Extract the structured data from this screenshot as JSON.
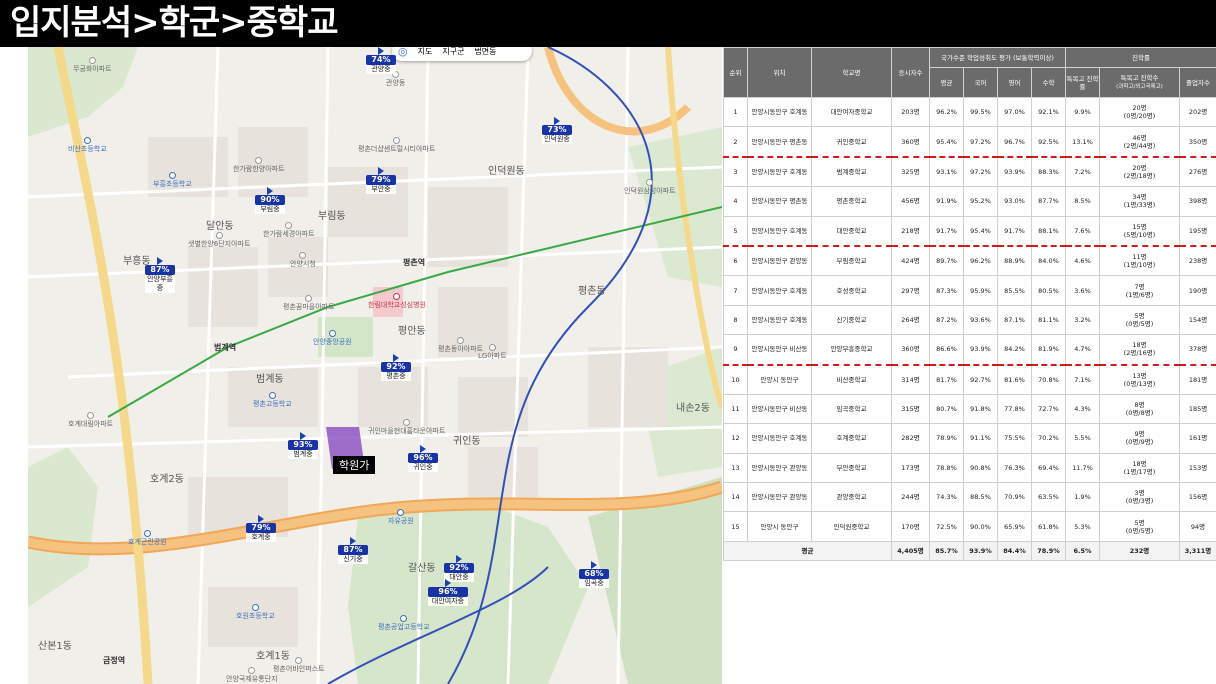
{
  "header": {
    "title": "입지분석>학군>중학교"
  },
  "map": {
    "controls": {
      "icon": "location-icon",
      "items": [
        "지도",
        "지구군",
        "법면동"
      ]
    },
    "academy_label": "학원가",
    "stations": [
      "평촌역",
      "범계역",
      "금정역"
    ],
    "districts": [
      "부림동",
      "평안동",
      "귀인동",
      "평촌동",
      "범계동",
      "호계2동",
      "갈산동",
      "호계1동",
      "부흥동",
      "산본1동",
      "달안동",
      "내손2동",
      "인덕원동"
    ],
    "pois": [
      {
        "name": "안양중앙공원",
        "style": "blue"
      },
      {
        "name": "평촌고등학교",
        "style": "blue"
      },
      {
        "name": "부흥초등학교",
        "style": "blue"
      },
      {
        "name": "한가람한양아파트",
        "style": "gray"
      },
      {
        "name": "안양시청",
        "style": "gray"
      },
      {
        "name": "평촌동아아파트",
        "style": "gray"
      },
      {
        "name": "평촌더샵센트럴시티아파트",
        "style": "gray"
      },
      {
        "name": "인덕원삼성아파트",
        "style": "gray"
      },
      {
        "name": "한림대학교성심병원",
        "style": "red"
      },
      {
        "name": "귀인마을현대홈타운아파트",
        "style": "gray"
      },
      {
        "name": "비산초등학교",
        "style": "blue"
      },
      {
        "name": "샛별한양6단지아파트",
        "style": "gray"
      },
      {
        "name": "평촌꿈마을아파트",
        "style": "gray"
      },
      {
        "name": "자유공원",
        "style": "blue"
      },
      {
        "name": "호계근린공원",
        "style": "blue"
      },
      {
        "name": "호원초등학교",
        "style": "blue"
      },
      {
        "name": "평촌공업고등학교",
        "style": "blue"
      },
      {
        "name": "평촌어바인퍼스트",
        "style": "gray"
      },
      {
        "name": "안양국제유통단지",
        "style": "gray"
      },
      {
        "name": "LG아파트",
        "style": "gray"
      },
      {
        "name": "관양동",
        "style": "gray"
      },
      {
        "name": "한가람세경아파트",
        "style": "gray"
      },
      {
        "name": "호계대림아파트",
        "style": "gray"
      },
      {
        "name": "무궁화아파트",
        "style": "gray"
      }
    ],
    "school_markers": [
      {
        "pct": "74%",
        "name": "관양중"
      },
      {
        "pct": "73%",
        "name": "인덕원중"
      },
      {
        "pct": "90%",
        "name": "부림중"
      },
      {
        "pct": "79%",
        "name": "부안중"
      },
      {
        "pct": "87%",
        "name": "안양부흥중"
      },
      {
        "pct": "92%",
        "name": "평촌중"
      },
      {
        "pct": "93%",
        "name": "범계중"
      },
      {
        "pct": "96%",
        "name": "귀인중"
      },
      {
        "pct": "79%",
        "name": "호계중"
      },
      {
        "pct": "87%",
        "name": "신기중"
      },
      {
        "pct": "92%",
        "name": "대안중"
      },
      {
        "pct": "96%",
        "name": "대안여자중"
      },
      {
        "pct": "68%",
        "name": "임곡중"
      }
    ]
  },
  "table": {
    "headers": {
      "rank": "순위",
      "location": "위치",
      "school": "학교명",
      "students": "응시자수",
      "achievement_group": "국가수준 학업성취도 평가 (보통학력이상)",
      "avg": "평균",
      "korean": "국어",
      "english": "영어",
      "math": "수학",
      "advancement_group": "진학률",
      "special_rate": "특목고 진학률",
      "special_count": "특목고 진학수",
      "special_count_sub": "(과학고/외고국제고)",
      "graduates": "졸업자수"
    },
    "rows": [
      {
        "rank": "1",
        "location": "안양시동안구 호계동",
        "school": "대안여자중학교",
        "students": "203명",
        "avg": "96.2%",
        "korean": "99.5%",
        "english": "97.0%",
        "math": "92.1%",
        "special_rate": "9.9%",
        "special_count": "20명",
        "special_detail": "(0명/20명)",
        "graduates": "202명"
      },
      {
        "rank": "2",
        "location": "안양시동안구 평촌동",
        "school": "귀인중학교",
        "students": "360명",
        "avg": "95.4%",
        "korean": "97.2%",
        "english": "96.7%",
        "math": "92.5%",
        "special_rate": "13.1%",
        "special_count": "46명",
        "special_detail": "(2명/44명)",
        "graduates": "350명"
      },
      {
        "rank": "3",
        "location": "안양시동안구 호계동",
        "school": "범계중학교",
        "students": "325명",
        "avg": "93.1%",
        "korean": "97.2%",
        "english": "93.9%",
        "math": "88.3%",
        "special_rate": "7.2%",
        "special_count": "20명",
        "special_detail": "(2명/18명)",
        "graduates": "276명"
      },
      {
        "rank": "4",
        "location": "안양시동안구 평촌동",
        "school": "평촌중학교",
        "students": "456명",
        "avg": "91.9%",
        "korean": "95.2%",
        "english": "93.0%",
        "math": "87.7%",
        "special_rate": "8.5%",
        "special_count": "34명",
        "special_detail": "(1명/33명)",
        "graduates": "398명"
      },
      {
        "rank": "5",
        "location": "안양시동안구 호계동",
        "school": "대안중학교",
        "students": "218명",
        "avg": "91.7%",
        "korean": "95.4%",
        "english": "91.7%",
        "math": "88.1%",
        "special_rate": "7.6%",
        "special_count": "15명",
        "special_detail": "(5명/10명)",
        "graduates": "195명"
      },
      {
        "rank": "6",
        "location": "안양시동안구 관양동",
        "school": "부림중학교",
        "students": "424명",
        "avg": "89.7%",
        "korean": "96.2%",
        "english": "88.9%",
        "math": "84.0%",
        "special_rate": "4.6%",
        "special_count": "11명",
        "special_detail": "(1명/10명)",
        "graduates": "238명"
      },
      {
        "rank": "7",
        "location": "안양시동안구 호계동",
        "school": "호성중학교",
        "students": "297명",
        "avg": "87.3%",
        "korean": "95.9%",
        "english": "85.5%",
        "math": "80.5%",
        "special_rate": "3.6%",
        "special_count": "7명",
        "special_detail": "(1명/6명)",
        "graduates": "190명"
      },
      {
        "rank": "8",
        "location": "안양시동안구 호계동",
        "school": "신기중학교",
        "students": "264명",
        "avg": "87.2%",
        "korean": "93.6%",
        "english": "87.1%",
        "math": "81.1%",
        "special_rate": "3.2%",
        "special_count": "5명",
        "special_detail": "(0명/5명)",
        "graduates": "154명"
      },
      {
        "rank": "9",
        "location": "안양시동안구 비산동",
        "school": "안양부흥중학교",
        "students": "360명",
        "avg": "86.6%",
        "korean": "93.9%",
        "english": "84.2%",
        "math": "81.9%",
        "special_rate": "4.7%",
        "special_count": "18명",
        "special_detail": "(2명/16명)",
        "graduates": "378명"
      },
      {
        "rank": "10",
        "location": "안양시 동안구",
        "school": "비산중학교",
        "students": "314명",
        "avg": "81.7%",
        "korean": "92.7%",
        "english": "81.6%",
        "math": "70.8%",
        "special_rate": "7.1%",
        "special_count": "13명",
        "special_detail": "(0명/13명)",
        "graduates": "181명"
      },
      {
        "rank": "11",
        "location": "안양시동안구 비산동",
        "school": "임곡중학교",
        "students": "315명",
        "avg": "80.7%",
        "korean": "91.8%",
        "english": "77.8%",
        "math": "72.7%",
        "special_rate": "4.3%",
        "special_count": "8명",
        "special_detail": "(0명/8명)",
        "graduates": "185명"
      },
      {
        "rank": "12",
        "location": "안양시동안구 호계동",
        "school": "호계중학교",
        "students": "282명",
        "avg": "78.9%",
        "korean": "91.1%",
        "english": "75.5%",
        "math": "70.2%",
        "special_rate": "5.5%",
        "special_count": "9명",
        "special_detail": "(0명/9명)",
        "graduates": "161명"
      },
      {
        "rank": "13",
        "location": "안양시동안구 관양동",
        "school": "부안중학교",
        "students": "173명",
        "avg": "78.8%",
        "korean": "90.8%",
        "english": "76.3%",
        "math": "69.4%",
        "special_rate": "11.7%",
        "special_count": "18명",
        "special_detail": "(1명/17명)",
        "graduates": "153명"
      },
      {
        "rank": "14",
        "location": "안양시동안구 관양동",
        "school": "관양중학교",
        "students": "244명",
        "avg": "74.3%",
        "korean": "88.5%",
        "english": "70.9%",
        "math": "63.5%",
        "special_rate": "1.9%",
        "special_count": "3명",
        "special_detail": "(0명/3명)",
        "graduates": "156명"
      },
      {
        "rank": "15",
        "location": "안양시 동안구",
        "school": "인덕원중학교",
        "students": "170명",
        "avg": "72.5%",
        "korean": "90.0%",
        "english": "65.9%",
        "math": "61.8%",
        "special_rate": "5.3%",
        "special_count": "5명",
        "special_detail": "(0명/5명)",
        "graduates": "94명"
      }
    ],
    "footer": {
      "label": "평균",
      "students": "4,405명",
      "avg": "85.7%",
      "korean": "93.9%",
      "english": "84.4%",
      "math": "78.9%",
      "special_rate": "6.5%",
      "special_count": "232명",
      "graduates": "3,311명"
    },
    "separator_after_ranks": [
      "2",
      "5",
      "9"
    ]
  },
  "colors": {
    "header_bg": "#000000",
    "table_header": "#6b6b6b",
    "marker_blue": "#1833a8",
    "academy_purple": "#8040be",
    "separator_red": "#d11b1b"
  }
}
